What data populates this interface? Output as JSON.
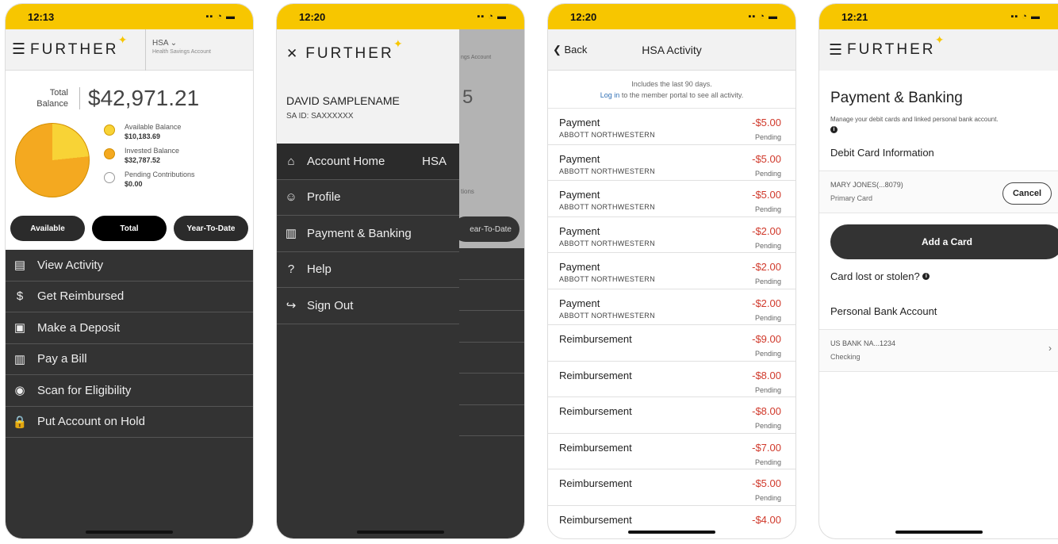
{
  "p1": {
    "time": "12:13",
    "status_icons": "▪▪ ◔ ▬",
    "logo": "FURTHER",
    "acct_type": "HSA ⌄",
    "acct_desc": "Health Savings Account",
    "total_label_1": "Total",
    "total_label_2": "Balance",
    "total": "$42,971.21",
    "legend": [
      {
        "label": "Available Balance",
        "value": "$10,183.69",
        "color": "#f8d336"
      },
      {
        "label": "Invested Balance",
        "value": "$32,787.52",
        "color": "#f4a920"
      },
      {
        "label": "Pending Contributions",
        "value": "$0.00",
        "color": "#ffffff"
      }
    ],
    "tabs": [
      "Available",
      "Total",
      "Year-To-Date"
    ],
    "menu": [
      {
        "icon": "▤",
        "label": "View Activity"
      },
      {
        "icon": "$",
        "label": "Get Reimbursed"
      },
      {
        "icon": "▣",
        "label": "Make a Deposit"
      },
      {
        "icon": "▥",
        "label": "Pay a Bill"
      },
      {
        "icon": "◉",
        "label": "Scan for Eligibility"
      },
      {
        "icon": "🔒",
        "label": "Put Account on Hold"
      }
    ]
  },
  "p2": {
    "time": "12:20",
    "status_icons": "▪▪ ◔ ▬",
    "close": "✕",
    "logo": "FURTHER",
    "name": "DAVID SAMPLENAME",
    "said": "SA ID: SAXXXXXX",
    "behind_acct": "ngs Account",
    "behind_five": "5",
    "behind_tions": "tions",
    "behind_pill": "ear-To-Date",
    "items": [
      {
        "icon": "⌂",
        "label": "Account Home",
        "right": "HSA"
      },
      {
        "icon": "☺",
        "label": "Profile",
        "right": ""
      },
      {
        "icon": "▥",
        "label": "Payment & Banking",
        "right": ""
      },
      {
        "icon": "?",
        "label": "Help",
        "right": ""
      },
      {
        "icon": "↪",
        "label": "Sign Out",
        "right": ""
      }
    ]
  },
  "p3": {
    "time": "12:20",
    "status_icons": "▪▪ ◔ ▬",
    "back": "❮ Back",
    "title": "HSA Activity",
    "note1": "Includes the last 90 days.",
    "note_link": "Log in",
    "note2": " to the member portal to see all activity.",
    "rows": [
      {
        "type": "Payment",
        "sub": "ABBOTT NORTHWESTERN",
        "amount": "-$5.00",
        "status": "Pending"
      },
      {
        "type": "Payment",
        "sub": "ABBOTT NORTHWESTERN",
        "amount": "-$5.00",
        "status": "Pending"
      },
      {
        "type": "Payment",
        "sub": "ABBOTT NORTHWESTERN",
        "amount": "-$5.00",
        "status": "Pending"
      },
      {
        "type": "Payment",
        "sub": "ABBOTT NORTHWESTERN",
        "amount": "-$2.00",
        "status": "Pending"
      },
      {
        "type": "Payment",
        "sub": "ABBOTT NORTHWESTERN",
        "amount": "-$2.00",
        "status": "Pending"
      },
      {
        "type": "Payment",
        "sub": "ABBOTT NORTHWESTERN",
        "amount": "-$2.00",
        "status": "Pending"
      },
      {
        "type": "Reimbursement",
        "sub": "",
        "amount": "-$9.00",
        "status": "Pending"
      },
      {
        "type": "Reimbursement",
        "sub": "",
        "amount": "-$8.00",
        "status": "Pending"
      },
      {
        "type": "Reimbursement",
        "sub": "",
        "amount": "-$8.00",
        "status": "Pending"
      },
      {
        "type": "Reimbursement",
        "sub": "",
        "amount": "-$7.00",
        "status": "Pending"
      },
      {
        "type": "Reimbursement",
        "sub": "",
        "amount": "-$5.00",
        "status": "Pending"
      },
      {
        "type": "Reimbursement",
        "sub": "",
        "amount": "-$4.00",
        "status": ""
      }
    ]
  },
  "p4": {
    "time": "12:21",
    "status_icons": "▪▪ ◔ ▬",
    "logo": "FURTHER",
    "title": "Payment & Banking",
    "desc": "Manage your debit cards and linked personal bank account.",
    "info_glyph": "i",
    "debit_title": "Debit Card Information",
    "card_name": "MARY JONES(...8079)",
    "card_type": "Primary Card",
    "cancel": "Cancel",
    "add_card": "Add a Card",
    "lost": "Card lost or stolen?",
    "bank_title": "Personal Bank Account",
    "bank_name": "US BANK NA...1234",
    "bank_type": "Checking",
    "chevron": "›"
  }
}
